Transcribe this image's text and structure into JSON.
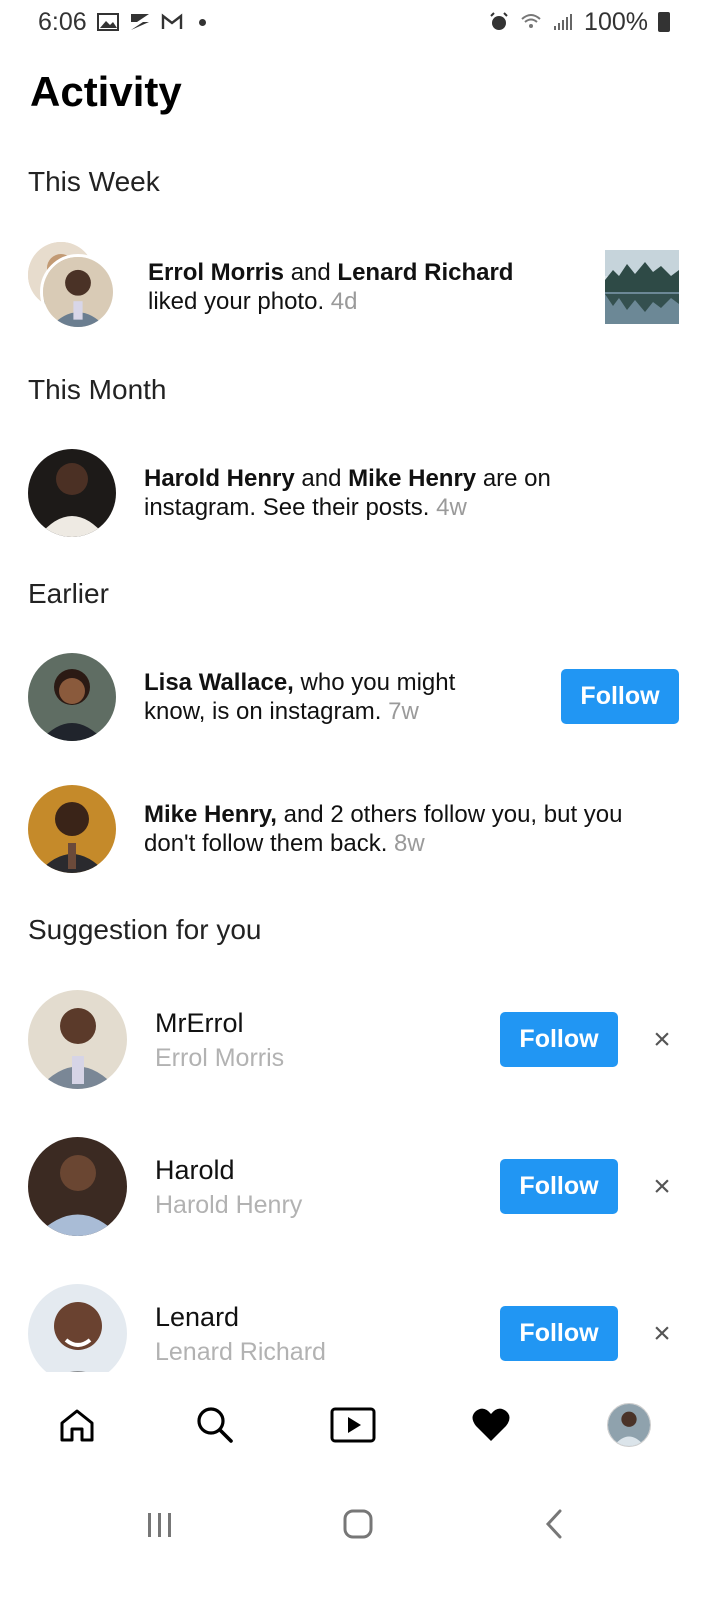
{
  "status_bar": {
    "time": "6:06",
    "battery": "100%",
    "left_icons": [
      "gallery-icon",
      "s-app-icon",
      "gmail-icon",
      "dot-icon"
    ],
    "right_icons": [
      "alarm-icon",
      "wifi-icon",
      "signal-icon",
      "battery-icon"
    ]
  },
  "page": {
    "title": "Activity"
  },
  "sections": {
    "this_week": "This Week",
    "this_month": "This Month",
    "earlier": "Earlier",
    "suggestions": "Suggestion for you"
  },
  "activity": {
    "week_item": {
      "user1": "Errol Morris",
      "join": " and ",
      "user2": "Lenard Richard",
      "action": "liked your photo. ",
      "time": "4d"
    },
    "month_item": {
      "user1": "Harold Henry",
      "join": " and ",
      "user2": "Mike Henry",
      "action_line1": " are on",
      "action_line2": "instagram. See their posts. ",
      "time": "4w"
    },
    "earlier_item1": {
      "user": "Lisa Wallace,",
      "action_line1": " who you might",
      "action_line2": "know, is on instagram. ",
      "time": "7w",
      "button": "Follow"
    },
    "earlier_item2": {
      "user": "Mike Henry,",
      "action_line1": " and 2 others follow you, but you",
      "action_line2": "don't follow them back. ",
      "time": "8w"
    }
  },
  "suggestions": [
    {
      "username": "MrErrol",
      "name": "Errol Morris",
      "button": "Follow",
      "dismiss": "×"
    },
    {
      "username": "Harold",
      "name": "Harold Henry",
      "button": "Follow",
      "dismiss": "×"
    },
    {
      "username": "Lenard",
      "name": "Lenard Richard",
      "button": "Follow",
      "dismiss": "×"
    }
  ],
  "bottom_nav": [
    "home-icon",
    "search-icon",
    "reels-icon",
    "heart-icon",
    "profile-avatar"
  ],
  "system_nav": [
    "recents-icon",
    "home-circle-icon",
    "back-icon"
  ],
  "colors": {
    "accent": "#2196f3",
    "muted": "#9a9a9a",
    "secondary": "#b2b2b2"
  }
}
